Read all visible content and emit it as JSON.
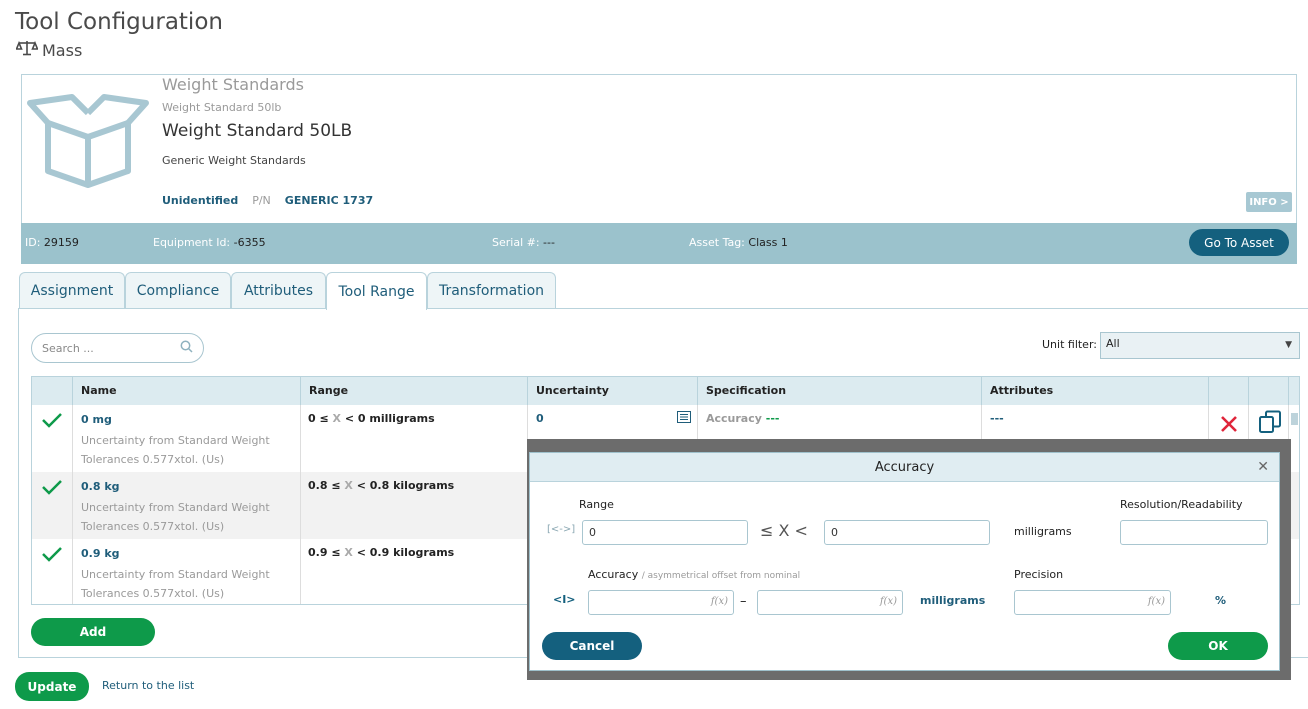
{
  "header": {
    "title": "Tool Configuration",
    "subtitle": "Mass"
  },
  "asset": {
    "category": "Weight Standards",
    "category_sub": "Weight Standard 50lb",
    "name": "Weight Standard 50LB",
    "description": "Generic Weight Standards",
    "status": "Unidentified",
    "pn_label": "P/N",
    "pn_value": "GENERIC 1737",
    "info_label": "INFO >",
    "id_label": "ID:",
    "id_value": "29159",
    "equipment_label": "Equipment Id:",
    "equipment_value": "-6355",
    "serial_label": "Serial #:",
    "serial_value": "---",
    "tag_label": "Asset Tag:",
    "tag_value": "Class 1",
    "goto_label": "Go To Asset"
  },
  "tabs": [
    {
      "label": "Assignment",
      "active": false
    },
    {
      "label": "Compliance",
      "active": false
    },
    {
      "label": "Attributes",
      "active": false
    },
    {
      "label": "Tool Range",
      "active": true
    },
    {
      "label": "Transformation",
      "active": false
    }
  ],
  "search": {
    "placeholder": "Search ..."
  },
  "unit_filter": {
    "label": "Unit filter:",
    "value": "All"
  },
  "table": {
    "columns": [
      "Name",
      "Range",
      "Uncertainty",
      "Specification",
      "Attributes"
    ],
    "rows": [
      {
        "name": "0 mg",
        "note": "Uncertainty from Standard Weight Tolerances 0.577xtol. (Us)",
        "range_low": "0 ≤",
        "range_x": "X",
        "range_high": "< 0 milligrams",
        "uncertainty": "0",
        "spec_label": "Accuracy",
        "spec_value": "---",
        "attributes": "---"
      },
      {
        "name": "0.8 kg",
        "note": "Uncertainty from Standard Weight Tolerances 0.577xtol. (Us)",
        "range_low": "0.8 ≤",
        "range_x": "X",
        "range_high": "< 0.8 kilograms"
      },
      {
        "name": "0.9 kg",
        "note": "Uncertainty from Standard Weight Tolerances 0.577xtol. (Us)",
        "range_low": "0.9 ≤",
        "range_x": "X",
        "range_high": "< 0.9 kilograms"
      }
    ]
  },
  "buttons": {
    "add": "Add",
    "update": "Update",
    "return": "Return to the list"
  },
  "modal": {
    "title": "Accuracy",
    "range_label": "Range",
    "range_low": "0",
    "range_high": "0",
    "range_op": "≤ X <",
    "range_unit": "milligrams",
    "resolution_label": "Resolution/Readability",
    "accuracy_label": "Accuracy",
    "accuracy_hint": "/ asymmetrical offset from nominal",
    "accuracy_unit": "milligrams",
    "dash": "–",
    "precision_label": "Precision",
    "precision_unit": "%",
    "fx": "f(x)",
    "cancel": "Cancel",
    "ok": "OK"
  },
  "colors": {
    "primary": "#14607e",
    "success": "#0e9a4a",
    "danger": "#e0253a",
    "bar": "#9bc2cc"
  }
}
